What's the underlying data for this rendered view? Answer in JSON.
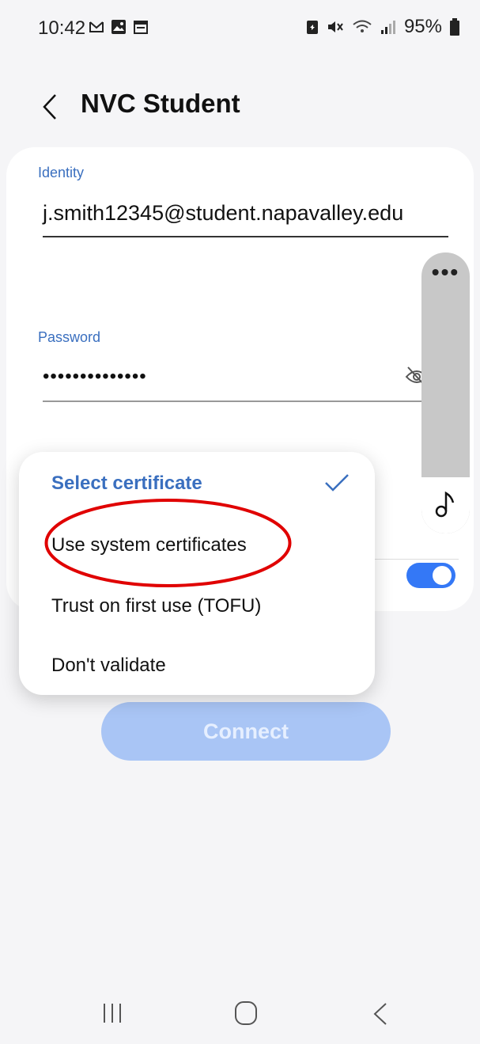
{
  "status_bar": {
    "time": "10:42",
    "battery": "95%"
  },
  "header": {
    "title": "NVC Student"
  },
  "form": {
    "identity_label": "Identity",
    "identity_value": "j.smith12345@student.napavalley.edu",
    "password_label": "Password",
    "password_value": "••••••••••••••"
  },
  "dropdown": {
    "title": "Select certificate",
    "options": [
      "Use system certificates",
      "Trust on first use (TOFU)",
      "Don't validate"
    ]
  },
  "connect_label": "Connect",
  "colors": {
    "accent": "#3478f6",
    "label_blue": "#3a6fbf",
    "connect_disabled": "#a9c5f5",
    "annotation_red": "#e00000"
  },
  "icons": [
    "back-icon",
    "gmail-icon",
    "gallery-icon",
    "calendar-icon",
    "battery-saver-icon",
    "mute-icon",
    "wifi-icon",
    "signal-icon",
    "battery-icon",
    "eye-icon",
    "check-icon",
    "more-icon",
    "music-icon",
    "recent-apps-icon",
    "home-icon",
    "nav-back-icon"
  ]
}
